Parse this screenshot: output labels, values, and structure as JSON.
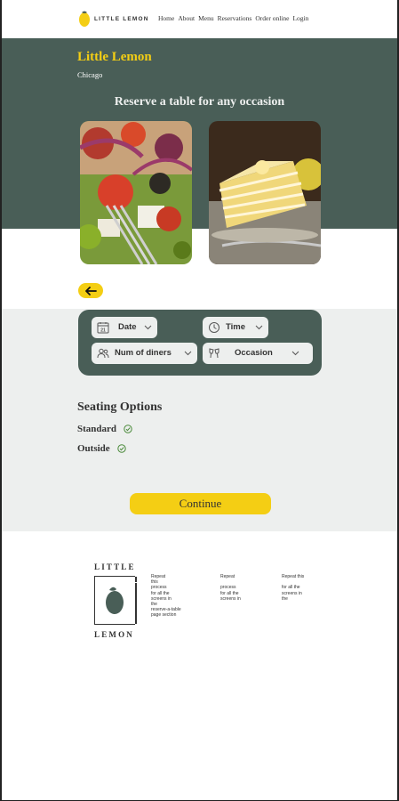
{
  "nav": {
    "logo_text": "LITTLE LEMON",
    "links": [
      "Home",
      "About",
      "Menu",
      "Reservations",
      "Order online",
      "Login"
    ]
  },
  "hero": {
    "title": "Little Lemon",
    "city": "Chicago",
    "tagline": "Reserve a table for any occasion"
  },
  "form": {
    "date_label": "Date",
    "time_label": "Time",
    "diners_label": "Num of diners",
    "occasion_label": "Occasion",
    "date_icon_number": "21"
  },
  "seating": {
    "title": "Seating Options",
    "options": [
      "Standard",
      "Outside"
    ]
  },
  "continue_label": "Continue",
  "footer": {
    "logo_top": "LITTLE",
    "logo_bottom": "LEMON",
    "col1": "Repeat\nthis\nprocess\nfor all the\nscreens in\nthe\nreserve-a-table\npage section",
    "col2": "Repeat\n\nprocess\nfor all the\nscreens in",
    "col3": "Repeat this\n\nfor all the\nscreens in\nthe"
  },
  "colors": {
    "primary_green": "#495e57",
    "primary_yellow": "#f4ce14",
    "light_gray": "#edefee",
    "text_dark": "#333333"
  },
  "icons": [
    "lemon-logo-icon",
    "arrow-left-icon",
    "calendar-icon",
    "clock-icon",
    "people-icon",
    "cheers-icon",
    "chevron-down-icon",
    "check-circle-icon"
  ]
}
